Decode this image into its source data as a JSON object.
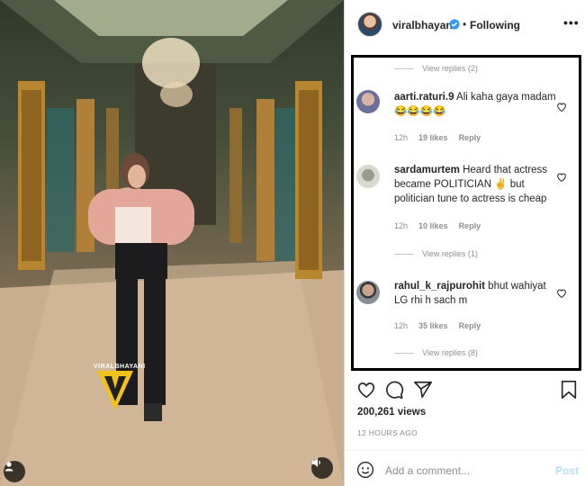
{
  "media": {
    "watermark": "VIRALBHAYANI",
    "user_icon": "user-silhouette-icon",
    "sound_icon": "speaker-muted-icon"
  },
  "header": {
    "username": "viralbhayani",
    "verified_icon": "verified-badge-icon",
    "separator": "•",
    "follow_status": "Following",
    "more_icon": "more-options-icon",
    "more_label": "•••"
  },
  "comments": {
    "top_view_replies": "View replies (2)",
    "items": [
      {
        "username": "aarti.raturi.9",
        "text": "Ali kaha gaya madam😂😂😂😂",
        "time": "12h",
        "likes": "19 likes",
        "reply": "Reply",
        "view_replies": ""
      },
      {
        "username": "sardamurtem",
        "text": "Heard that actress became POLITICIAN ✌ but politician tune to actress is cheap",
        "time": "12h",
        "likes": "10 likes",
        "reply": "Reply",
        "view_replies": "View replies (1)"
      },
      {
        "username": "rahul_k_rajpurohit",
        "text": "bhut wahiyat LG rhi h sach m",
        "time": "12h",
        "likes": "35 likes",
        "reply": "Reply",
        "view_replies": "View replies (8)"
      }
    ]
  },
  "actions": {
    "like_icon": "heart-icon",
    "comment_icon": "comment-bubble-icon",
    "share_icon": "paper-plane-icon",
    "save_icon": "bookmark-icon"
  },
  "stats": {
    "views": "200,261 views",
    "posted": "12 HOURS AGO"
  },
  "composer": {
    "emoji_icon": "smiley-face-icon",
    "placeholder": "Add a comment...",
    "post_label": "Post"
  },
  "colors": {
    "text": "#262626",
    "muted": "#8e8e8e",
    "verified": "#3897f0",
    "post_disabled": "#b2dffc",
    "watermark": "#f2c21b"
  }
}
